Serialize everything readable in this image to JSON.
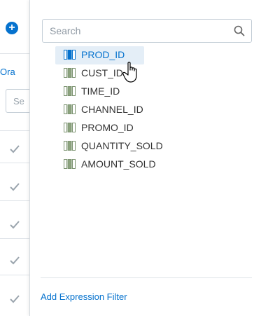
{
  "background": {
    "add_icon": "plus-circle-icon",
    "ora_link": "Ora",
    "search_placeholder": "Se",
    "check_icon": "checkmark-icon"
  },
  "popup": {
    "search": {
      "placeholder": "Search",
      "value": ""
    },
    "columns": [
      {
        "label": "PROD_ID",
        "state": "hover"
      },
      {
        "label": "CUST_ID",
        "state": "normal"
      },
      {
        "label": "TIME_ID",
        "state": "normal"
      },
      {
        "label": "CHANNEL_ID",
        "state": "normal"
      },
      {
        "label": "PROMO_ID",
        "state": "normal"
      },
      {
        "label": "QUANTITY_SOLD",
        "state": "normal"
      },
      {
        "label": "AMOUNT_SOLD",
        "state": "normal"
      }
    ],
    "footer_link": "Add Expression Filter"
  },
  "colors": {
    "accent": "#0572ce",
    "hover_bg": "#e4eef7",
    "icon_green": "#8ca37e"
  }
}
